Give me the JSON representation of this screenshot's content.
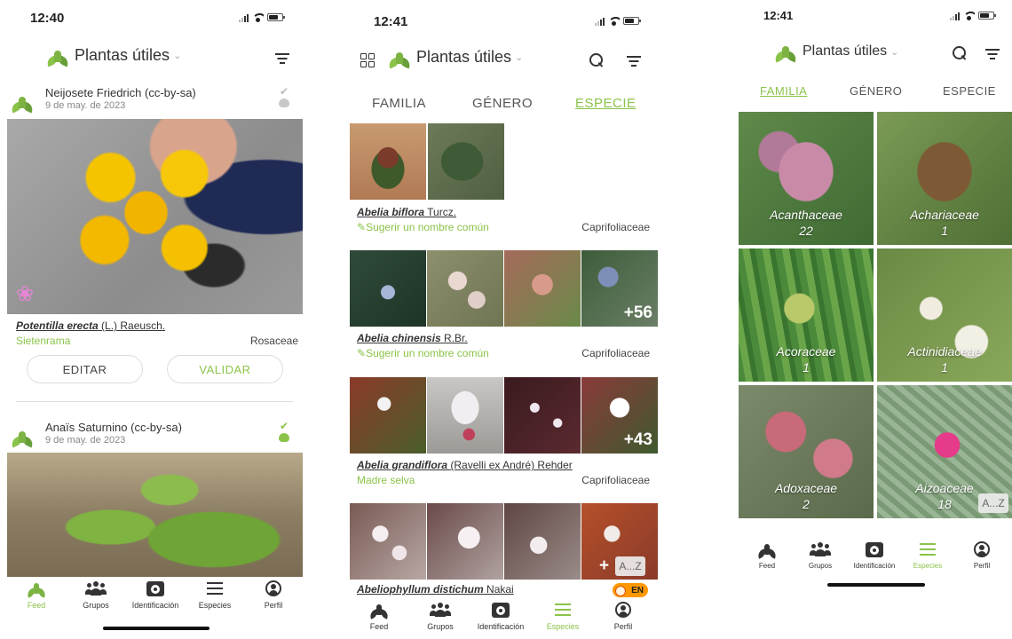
{
  "app": {
    "title": "Plantas útiles"
  },
  "screens": [
    {
      "time": "12:40",
      "posts": [
        {
          "author": "Neijosete Friedrich (cc-by-sa)",
          "date": "9 de may. de 2023",
          "scientific_name": "Potentilla erecta",
          "authority": "(L.) Raeusch.",
          "common_name": "Sietenrama",
          "family": "Rosaceae",
          "actions": [
            "EDITAR",
            "VALIDAR"
          ]
        },
        {
          "author": "Anaïs Saturnino (cc-by-sa)",
          "date": "9 de may. de 2023"
        }
      ]
    },
    {
      "time": "12:41",
      "tabs": [
        "FAMILIA",
        "GÉNERO",
        "ESPECIE"
      ],
      "active_tab": "ESPECIE",
      "species": [
        {
          "scientific_name": "Abelia biflora",
          "authority": "Turcz.",
          "common_name": "Sugerir un nombre común",
          "family": "Caprifoliaceae",
          "more": ""
        },
        {
          "scientific_name": "Abelia chinensis",
          "authority": "R.Br.",
          "common_name": "Sugerir un nombre común",
          "family": "Caprifoliaceae",
          "more": "+56"
        },
        {
          "scientific_name": "Abelia grandiflora",
          "authority": "(Ravelli ex André) Rehder",
          "common_name": "Madre selva",
          "family": "Caprifoliaceae",
          "more": "+43"
        },
        {
          "scientific_name": "Abeliophyllum distichum",
          "authority": "Nakai",
          "status_badge": "EN",
          "more": "+"
        }
      ],
      "az_label": "A...Z"
    },
    {
      "time": "12:41",
      "tabs": [
        "FAMILIA",
        "GÉNERO",
        "ESPECIE"
      ],
      "active_tab": "FAMILIA",
      "families": [
        {
          "name": "Acanthaceae",
          "count": "22"
        },
        {
          "name": "Achariaceae",
          "count": "1"
        },
        {
          "name": "Acoraceae",
          "count": "1"
        },
        {
          "name": "Actinidiaceae",
          "count": "1"
        },
        {
          "name": "Adoxaceae",
          "count": "2"
        },
        {
          "name": "Aizoaceae",
          "count": "18"
        }
      ],
      "az_label": "A...Z"
    }
  ],
  "nav": [
    "Feed",
    "Grupos",
    "Identificación",
    "Especies",
    "Perfil"
  ],
  "colors": {
    "accent": "#8bc34a",
    "text": "#333333",
    "muted": "#888888"
  }
}
